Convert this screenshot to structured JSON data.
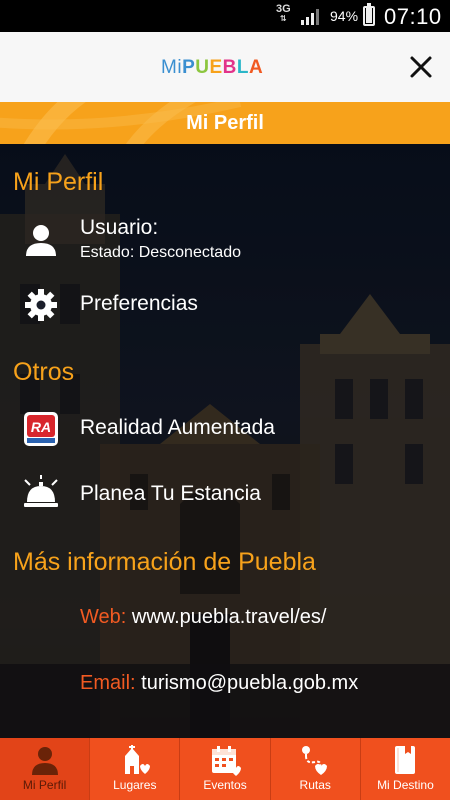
{
  "status_bar": {
    "network": "3G",
    "battery_percent": "94%",
    "battery_level": 0.94,
    "time": "07:10"
  },
  "header": {
    "logo_mi": "Mi",
    "logo_puebla": "PUEBLA",
    "close_icon": "close-icon"
  },
  "title_bar": {
    "title": "Mi Perfil"
  },
  "profile": {
    "section_title": "Mi Perfil",
    "user_label": "Usuario:",
    "status_text": "Estado: Desconectado",
    "preferences_label": "Preferencias"
  },
  "others": {
    "section_title": "Otros",
    "ar_label": "Realidad Aumentada",
    "ar_badge": "RA",
    "plan_label": "Planea Tu Estancia"
  },
  "more_info": {
    "section_title": "Más información de Puebla",
    "web_key": "Web:",
    "web_value": "www.puebla.travel/es/",
    "email_key": "Email:",
    "email_value": "turismo@puebla.gob.mx"
  },
  "bottom_nav": {
    "tabs": [
      {
        "label": "Mi Perfil",
        "icon": "person-icon",
        "active": true
      },
      {
        "label": "Lugares",
        "icon": "church-icon",
        "active": false
      },
      {
        "label": "Eventos",
        "icon": "calendar-icon",
        "active": false
      },
      {
        "label": "Rutas",
        "icon": "route-icon",
        "active": false
      },
      {
        "label": "Mi Destino",
        "icon": "book-icon",
        "active": false
      }
    ]
  },
  "colors": {
    "accent_orange": "#f7a21b",
    "nav_orange": "#f0501e",
    "link_key_red": "#f15a22"
  }
}
